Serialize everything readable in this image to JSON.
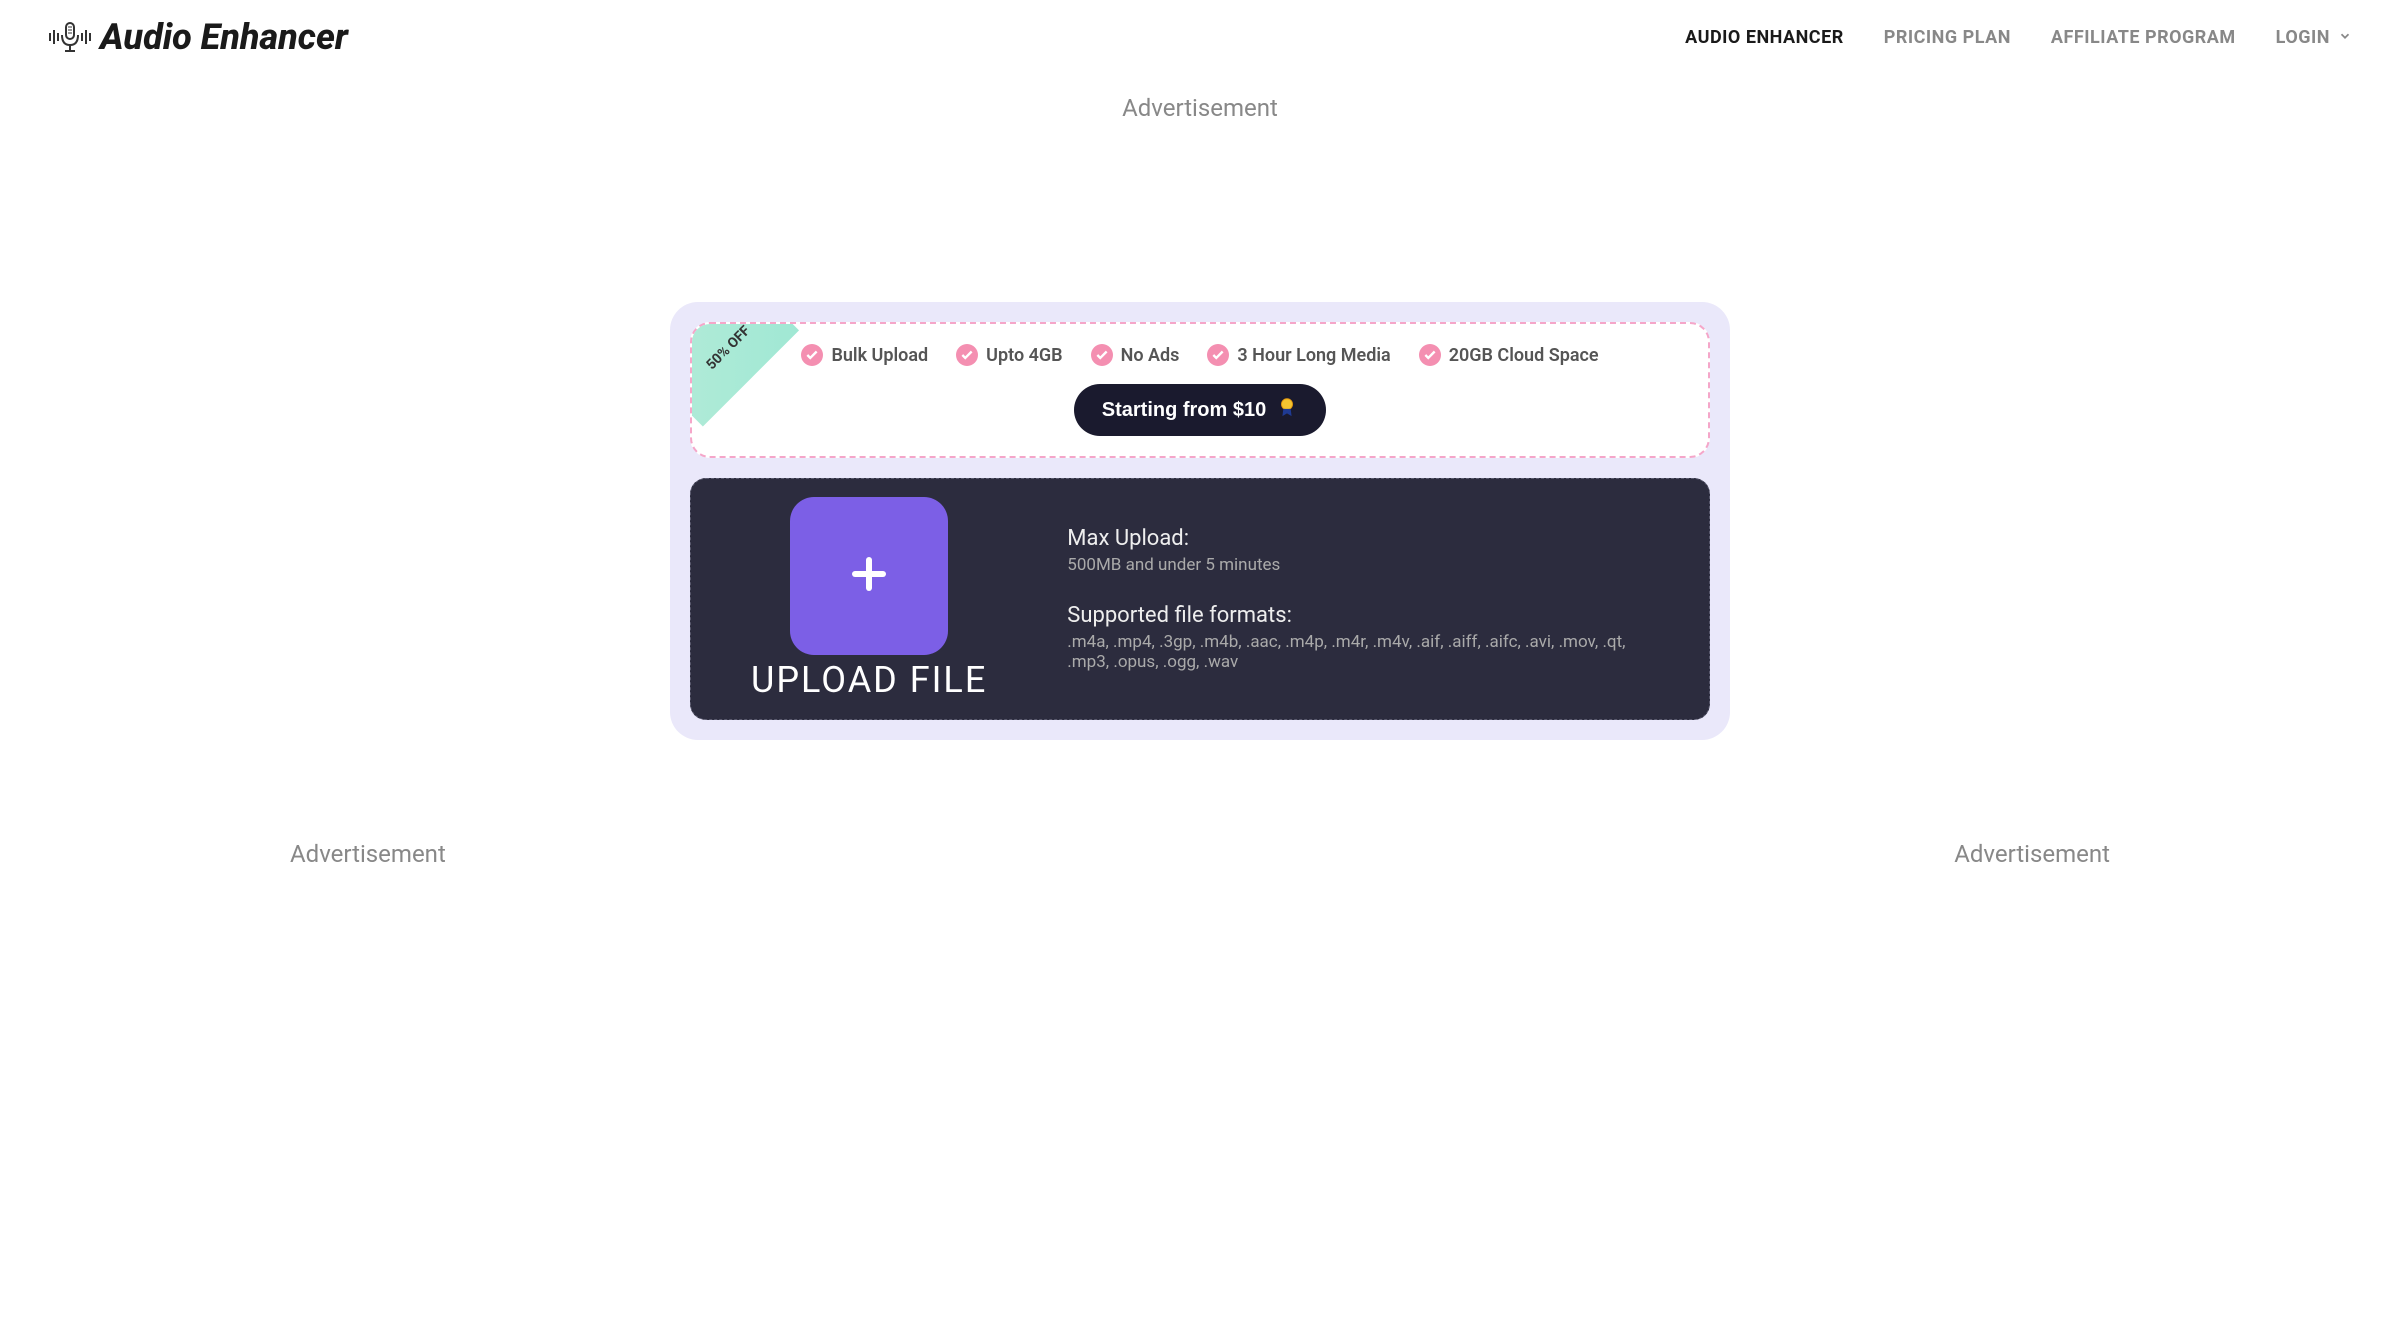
{
  "header": {
    "logo_text": "Audio Enhancer",
    "nav": [
      {
        "label": "AUDIO ENHANCER",
        "active": true
      },
      {
        "label": "PRICING PLAN",
        "active": false
      },
      {
        "label": "AFFILIATE PROGRAM",
        "active": false
      },
      {
        "label": "LOGIN",
        "active": false,
        "has_chevron": true
      }
    ]
  },
  "ads": {
    "top": "Advertisement",
    "bottom_left": "Advertisement",
    "bottom_right": "Advertisement"
  },
  "promo": {
    "ribbon": "50% OFF",
    "features": [
      "Bulk Upload",
      "Upto 4GB",
      "No Ads",
      "3 Hour Long Media",
      "20GB Cloud Space"
    ],
    "price_button": "Starting from $10"
  },
  "upload": {
    "button_label": "UPLOAD FILE",
    "max_upload_title": "Max Upload:",
    "max_upload_detail": "500MB and under 5 minutes",
    "formats_title": "Supported file formats:",
    "formats_detail": ".m4a, .mp4, .3gp, .m4b, .aac, .m4p, .m4r, .m4v, .aif, .aiff, .aifc, .avi, .mov, .qt, .mp3, .opus, .ogg, .wav"
  }
}
